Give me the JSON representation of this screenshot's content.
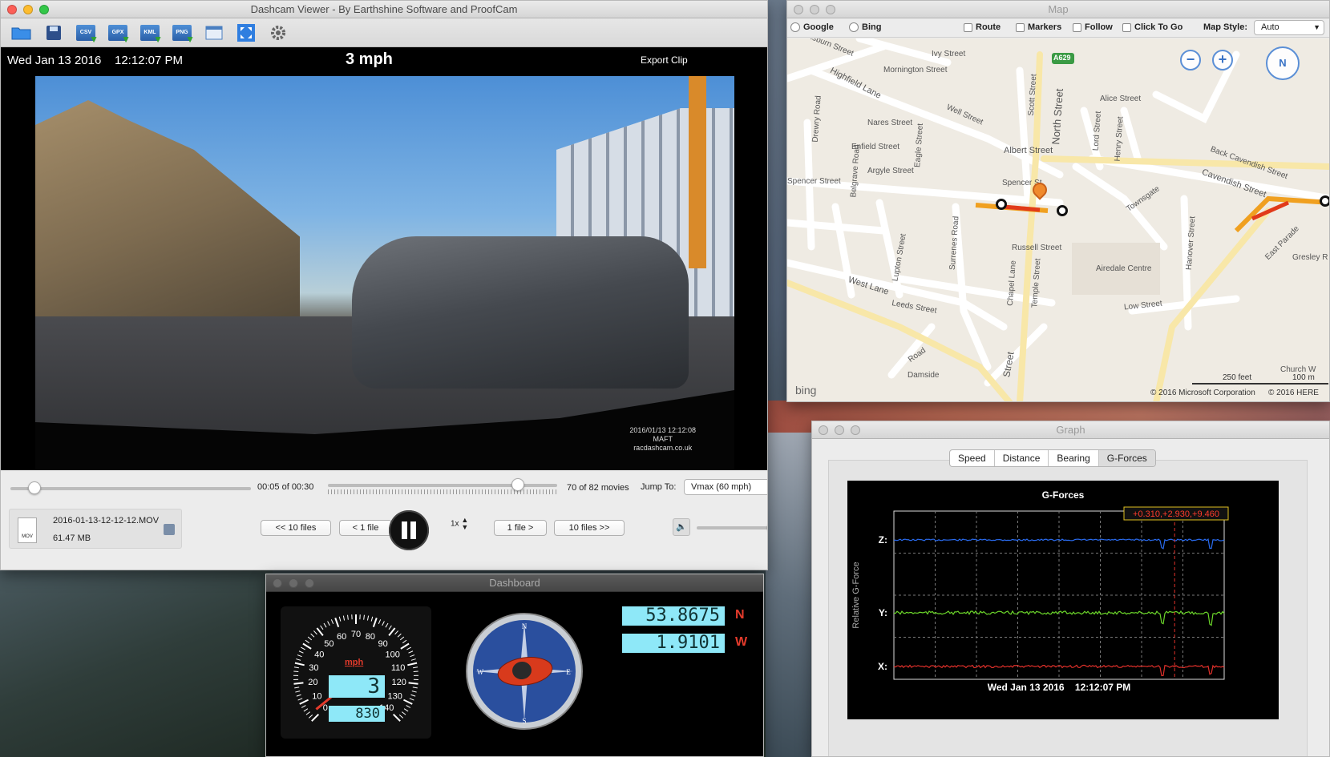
{
  "viewer": {
    "title": "Dashcam Viewer - By Earthshine Software and ProofCam",
    "toolbar": [
      "open-folder-icon",
      "save-icon",
      "export-csv-icon",
      "export-gpx-icon",
      "export-kml-icon",
      "export-png-icon",
      "window-icon",
      "fullscreen-icon",
      "settings-icon"
    ],
    "toolbar_labels": {
      "csv": "CSV",
      "gpx": "GPX",
      "kml": "KML",
      "png": "PNG"
    },
    "overlay": {
      "datetime": "Wed Jan 13 2016    12:12:07 PM",
      "speed": "3 mph",
      "export": "Export Clip"
    },
    "stamp": {
      "line1": "2016/01/13 12:12:08",
      "line2": "MAFT",
      "line3": "racdashcam.co.uk"
    },
    "time_position": 0.1,
    "time_text": "00:05 of 00:30",
    "movie_position": 0.83,
    "movie_count": "70 of 82 movies",
    "jump_to_label": "Jump To:",
    "jump_to_value": "Vmax (60 mph)",
    "file": {
      "name": "2016-01-13-12-12-12.MOV",
      "size": "61.47 MB",
      "icon_label": "MOV"
    },
    "buttons": {
      "back10": "<< 10 files",
      "back1": "< 1 file",
      "fwd1": "1 file >",
      "fwd10": "10 files >>"
    },
    "rate": "1x",
    "volume_level": 0.92
  },
  "map": {
    "title": "Map",
    "providers": [
      {
        "label": "Google",
        "selected": false
      },
      {
        "label": "Bing",
        "selected": false
      }
    ],
    "options": [
      {
        "label": "Route",
        "checked": false
      },
      {
        "label": "Markers",
        "checked": false
      },
      {
        "label": "Follow",
        "checked": false
      },
      {
        "label": "Click To Go",
        "checked": false
      }
    ],
    "style_label": "Map Style:",
    "style_value": "Auto",
    "streets": [
      "Ivy Street",
      "Mornington Street",
      "Highfield Lane",
      "Well Street",
      "Nares Street",
      "Enfield Street",
      "Argyle Street",
      "Albert Street",
      "Spencer Street",
      "Spencer St",
      "Russell Street",
      "North Street",
      "Alice Street",
      "Lord Street",
      "Henry Street",
      "Back Cavendish Street",
      "Cavendish Street",
      "Townsgate",
      "Airedale Centre",
      "Low Street",
      "Hanover Street",
      "West Lane",
      "Leeds Street",
      "Temple Street",
      "Chapel Lane",
      "Lupton Street",
      "Damside",
      "Drewry Road",
      "Belgrave Road",
      "Eagle Street",
      "Scott Street",
      "Surrenes Road",
      "Gresley R",
      "Church W",
      "Gisburn Street",
      "Street",
      "Road",
      "East Parade"
    ],
    "road_badge": "A629",
    "scale": {
      "feet": "250 feet",
      "meters": "100 m"
    },
    "credits": {
      "ms": "© 2016 Microsoft Corporation",
      "here": "© 2016 HERE"
    },
    "brand": "bing",
    "compass_label": "N",
    "zoom_out": "−",
    "zoom_in": "+"
  },
  "graph": {
    "title": "Graph",
    "tabs": [
      "Speed",
      "Distance",
      "Bearing",
      "G-Forces"
    ],
    "active_tab": "G-Forces",
    "chart_data": {
      "type": "line",
      "title": "G-Forces",
      "ylabel": "Relative G-Force",
      "xlabel": "Wed Jan 13 2016    12:12:07 PM",
      "readout": "+0.310,+2.930,+9.460",
      "series": [
        {
          "name": "Z:",
          "color": "#2a6cf0"
        },
        {
          "name": "Y:",
          "color": "#6bd62a"
        },
        {
          "name": "X:",
          "color": "#e0302a"
        }
      ],
      "cursor_position": 0.85,
      "grid": true
    }
  },
  "dashboard": {
    "title": "Dashboard",
    "speed_unit": "mph",
    "speed_value": "3",
    "odometer": "830",
    "speed_ticks": [
      0,
      10,
      20,
      30,
      40,
      50,
      60,
      70,
      80,
      90,
      100,
      110,
      120,
      130,
      140
    ],
    "speed": 3,
    "compass_labels": [
      "N",
      "E",
      "S",
      "W"
    ],
    "latitude": "53.8675",
    "lat_dir": "N",
    "longitude": "1.9101",
    "lon_dir": "W"
  }
}
